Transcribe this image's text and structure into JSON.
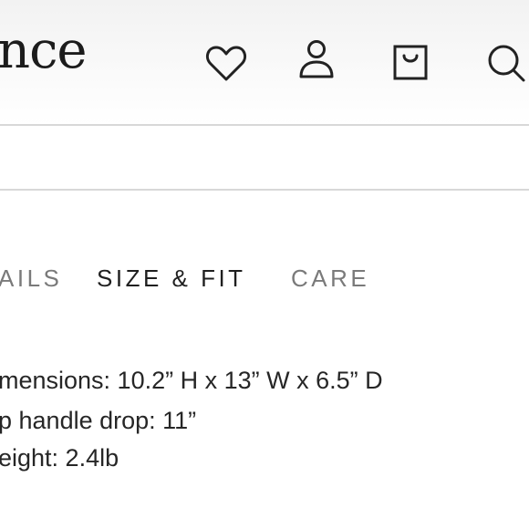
{
  "header": {
    "logo_text": "nce",
    "icons": {
      "wishlist": "heart-icon",
      "account": "user-icon",
      "cart": "shopping-bag-icon",
      "search": "search-icon"
    }
  },
  "tabs": [
    {
      "label": "AILS",
      "active": false
    },
    {
      "label": "SIZE & FIT",
      "active": true
    },
    {
      "label": "CARE",
      "active": false
    }
  ],
  "specs": [
    "mensions: 10.2” H x 13” W x 6.5” D",
    "p handle drop: 11”",
    "eight: 2.4lb"
  ],
  "colors": {
    "text_primary": "#1f1f1f",
    "text_muted": "#7a7a7a",
    "divider": "#d8d8d8",
    "header_bg": "#f4f4f4"
  }
}
